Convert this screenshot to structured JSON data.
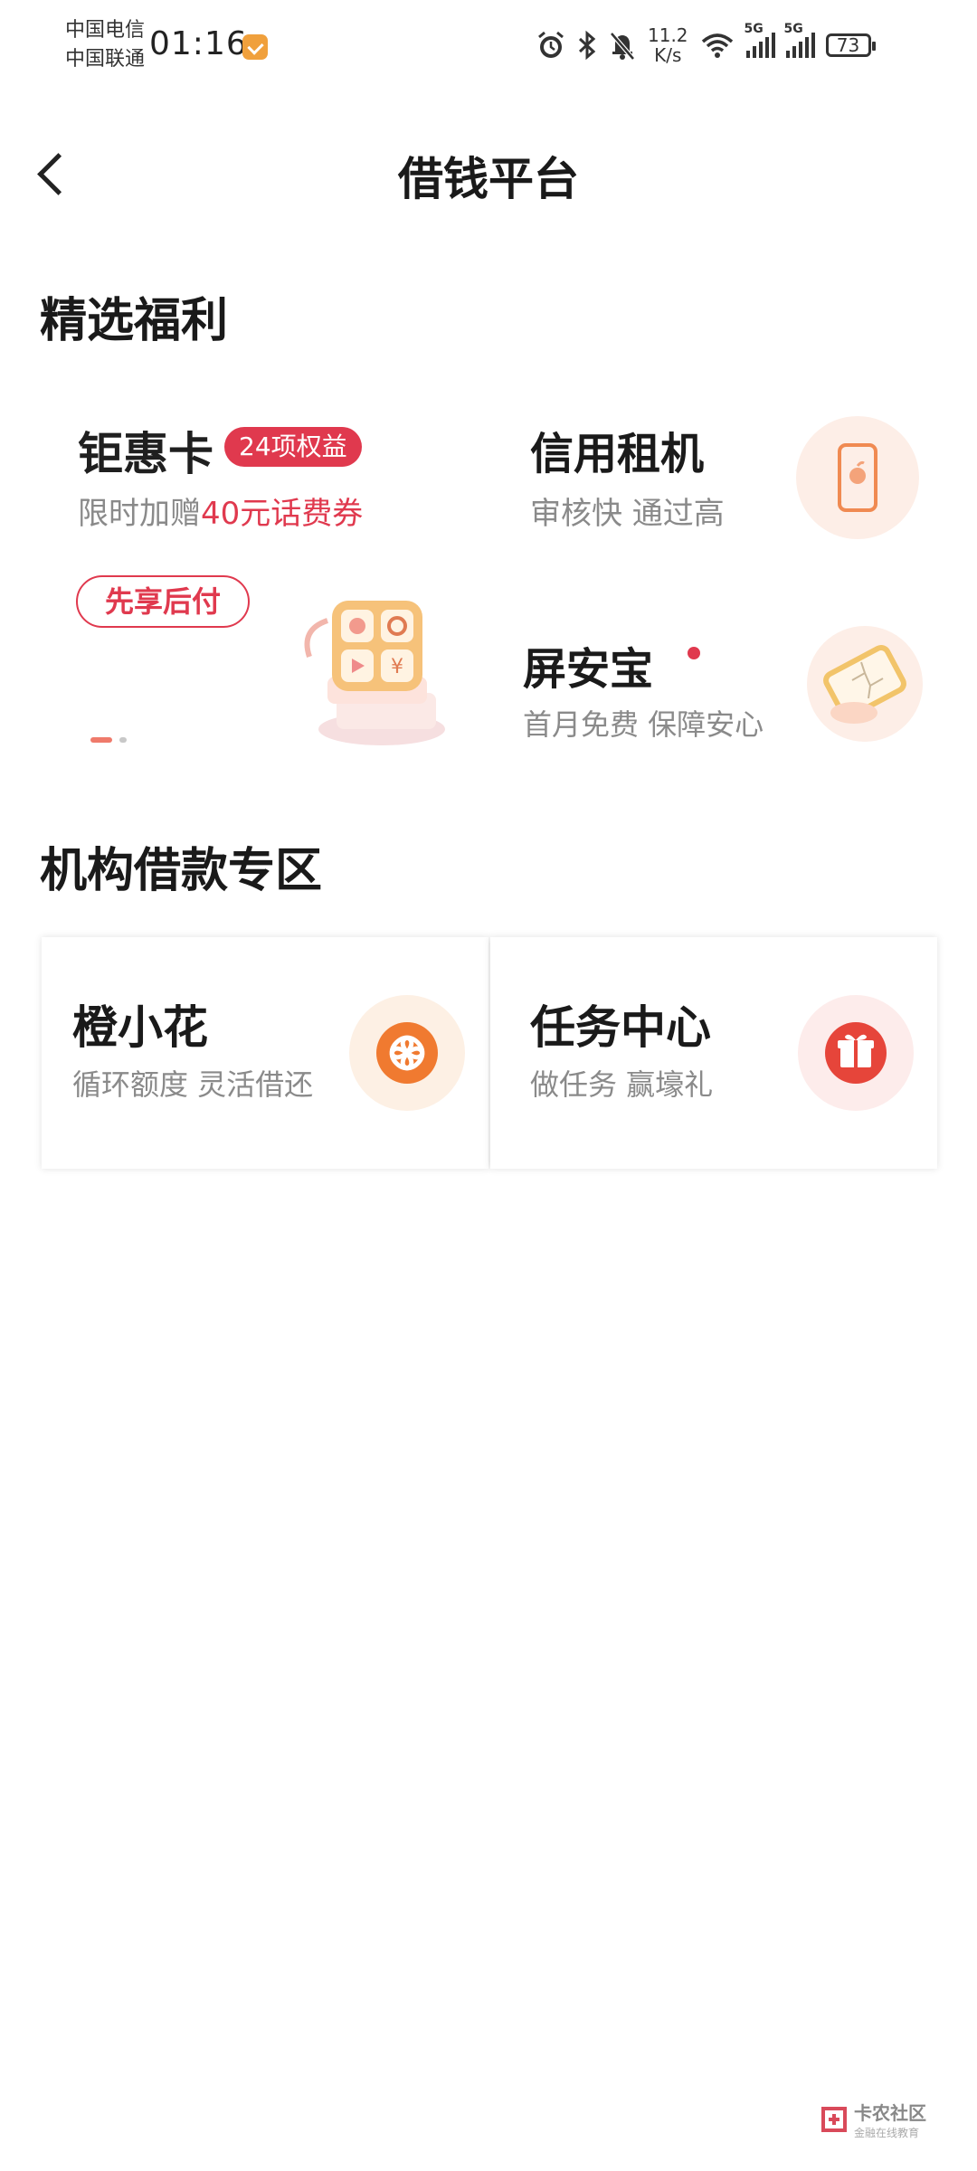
{
  "status_bar": {
    "carrier1": "中国电信",
    "carrier2": "中国联通",
    "time": "01:16",
    "speed_value": "11.2",
    "speed_unit": "K/s",
    "signal1_label": "5G",
    "signal2_label": "5G",
    "battery": "73",
    "icons": [
      "alarm-icon",
      "bluetooth-icon",
      "mute-icon",
      "wifi-icon"
    ]
  },
  "nav": {
    "title": "借钱平台",
    "back_icon": "chevron-left-icon"
  },
  "featured": {
    "section_title": "精选福利",
    "main": {
      "title": "钜惠卡",
      "tag": "24项权益",
      "subtitle_prefix": "限时加赠",
      "subtitle_highlight": "40元话费券",
      "button": "先享后付",
      "carousel_dots": 2,
      "carousel_active": 1
    },
    "side": [
      {
        "title": "信用租机",
        "subtitle": "审核快 通过高",
        "icon": "phone-icon"
      },
      {
        "title": "屏安宝",
        "subtitle": "首月免费 保障安心",
        "icon": "cracked-screen-icon",
        "has_dot": true
      }
    ]
  },
  "loan_zone": {
    "section_title": "机构借款专区",
    "cards": [
      {
        "title": "橙小花",
        "subtitle": "循环额度 灵活借还",
        "icon": "orange-flower-icon"
      },
      {
        "title": "任务中心",
        "subtitle": "做任务 赢壕礼",
        "icon": "gift-icon"
      }
    ]
  },
  "watermark": {
    "title": "卡农社区",
    "subtitle": "金融在线教育"
  },
  "colors": {
    "accent": "#e0394e",
    "orange": "#f07a30",
    "gray_text": "#8a8a8a"
  }
}
